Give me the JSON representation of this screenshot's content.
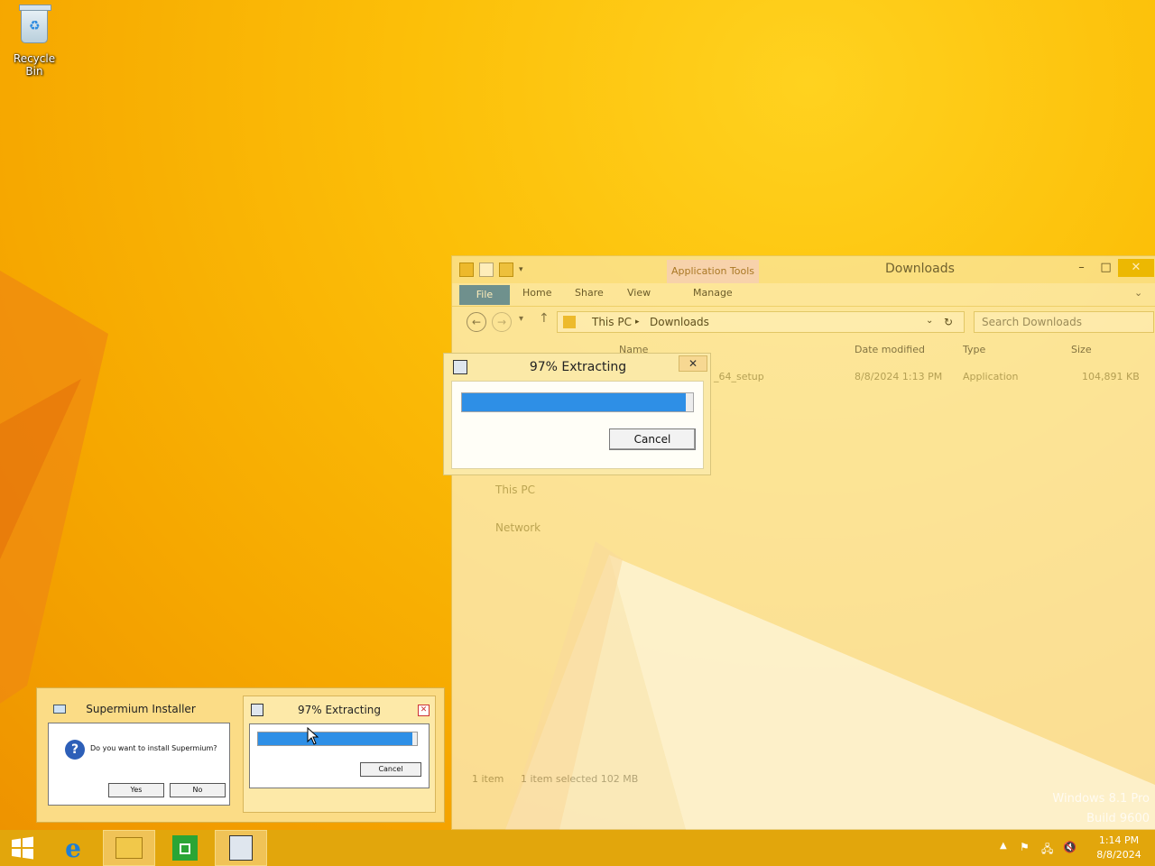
{
  "desktop": {
    "recycle_bin_label": "Recycle Bin",
    "watermark_line1": "Windows 8.1 Pro",
    "watermark_line2": "Build 9600"
  },
  "explorer": {
    "contextual_tab": "Application Tools",
    "title": "Downloads",
    "ribbon_tabs": [
      "File",
      "Home",
      "Share",
      "View",
      "Manage"
    ],
    "breadcrumb": [
      "This PC",
      "Downloads"
    ],
    "search_placeholder": "Search Downloads",
    "columns": [
      "Name",
      "Date modified",
      "Type",
      "Size"
    ],
    "file_row": {
      "name": "_64_setup",
      "date": "8/8/2024 1:13 PM",
      "type": "Application",
      "size": "104,891 KB"
    },
    "nav_pane": [
      "This PC",
      "Network"
    ],
    "status_items": "1 item",
    "status_selected": "1 item selected  102 MB"
  },
  "extract_dialog": {
    "title": "97% Extracting",
    "progress": 0.97,
    "cancel_label": "Cancel",
    "close_label": "✕"
  },
  "preview": {
    "installer": {
      "title": "Supermium Installer",
      "question": "Do you want to install Supermium?",
      "yes_label": "Yes",
      "no_label": "No"
    },
    "extracting": {
      "title": "97% Extracting",
      "cancel_label": "Cancel"
    }
  },
  "taskbar": {
    "items": [
      "start-button",
      "internet-explorer-icon",
      "file-explorer-icon",
      "store-icon",
      "installer-icon"
    ],
    "time": "1:14 PM",
    "date": "8/8/2024"
  },
  "colors": {
    "accent": "#2e8fe6",
    "file_tab": "#3a7fc1",
    "wallpaper": "#f5b400"
  }
}
